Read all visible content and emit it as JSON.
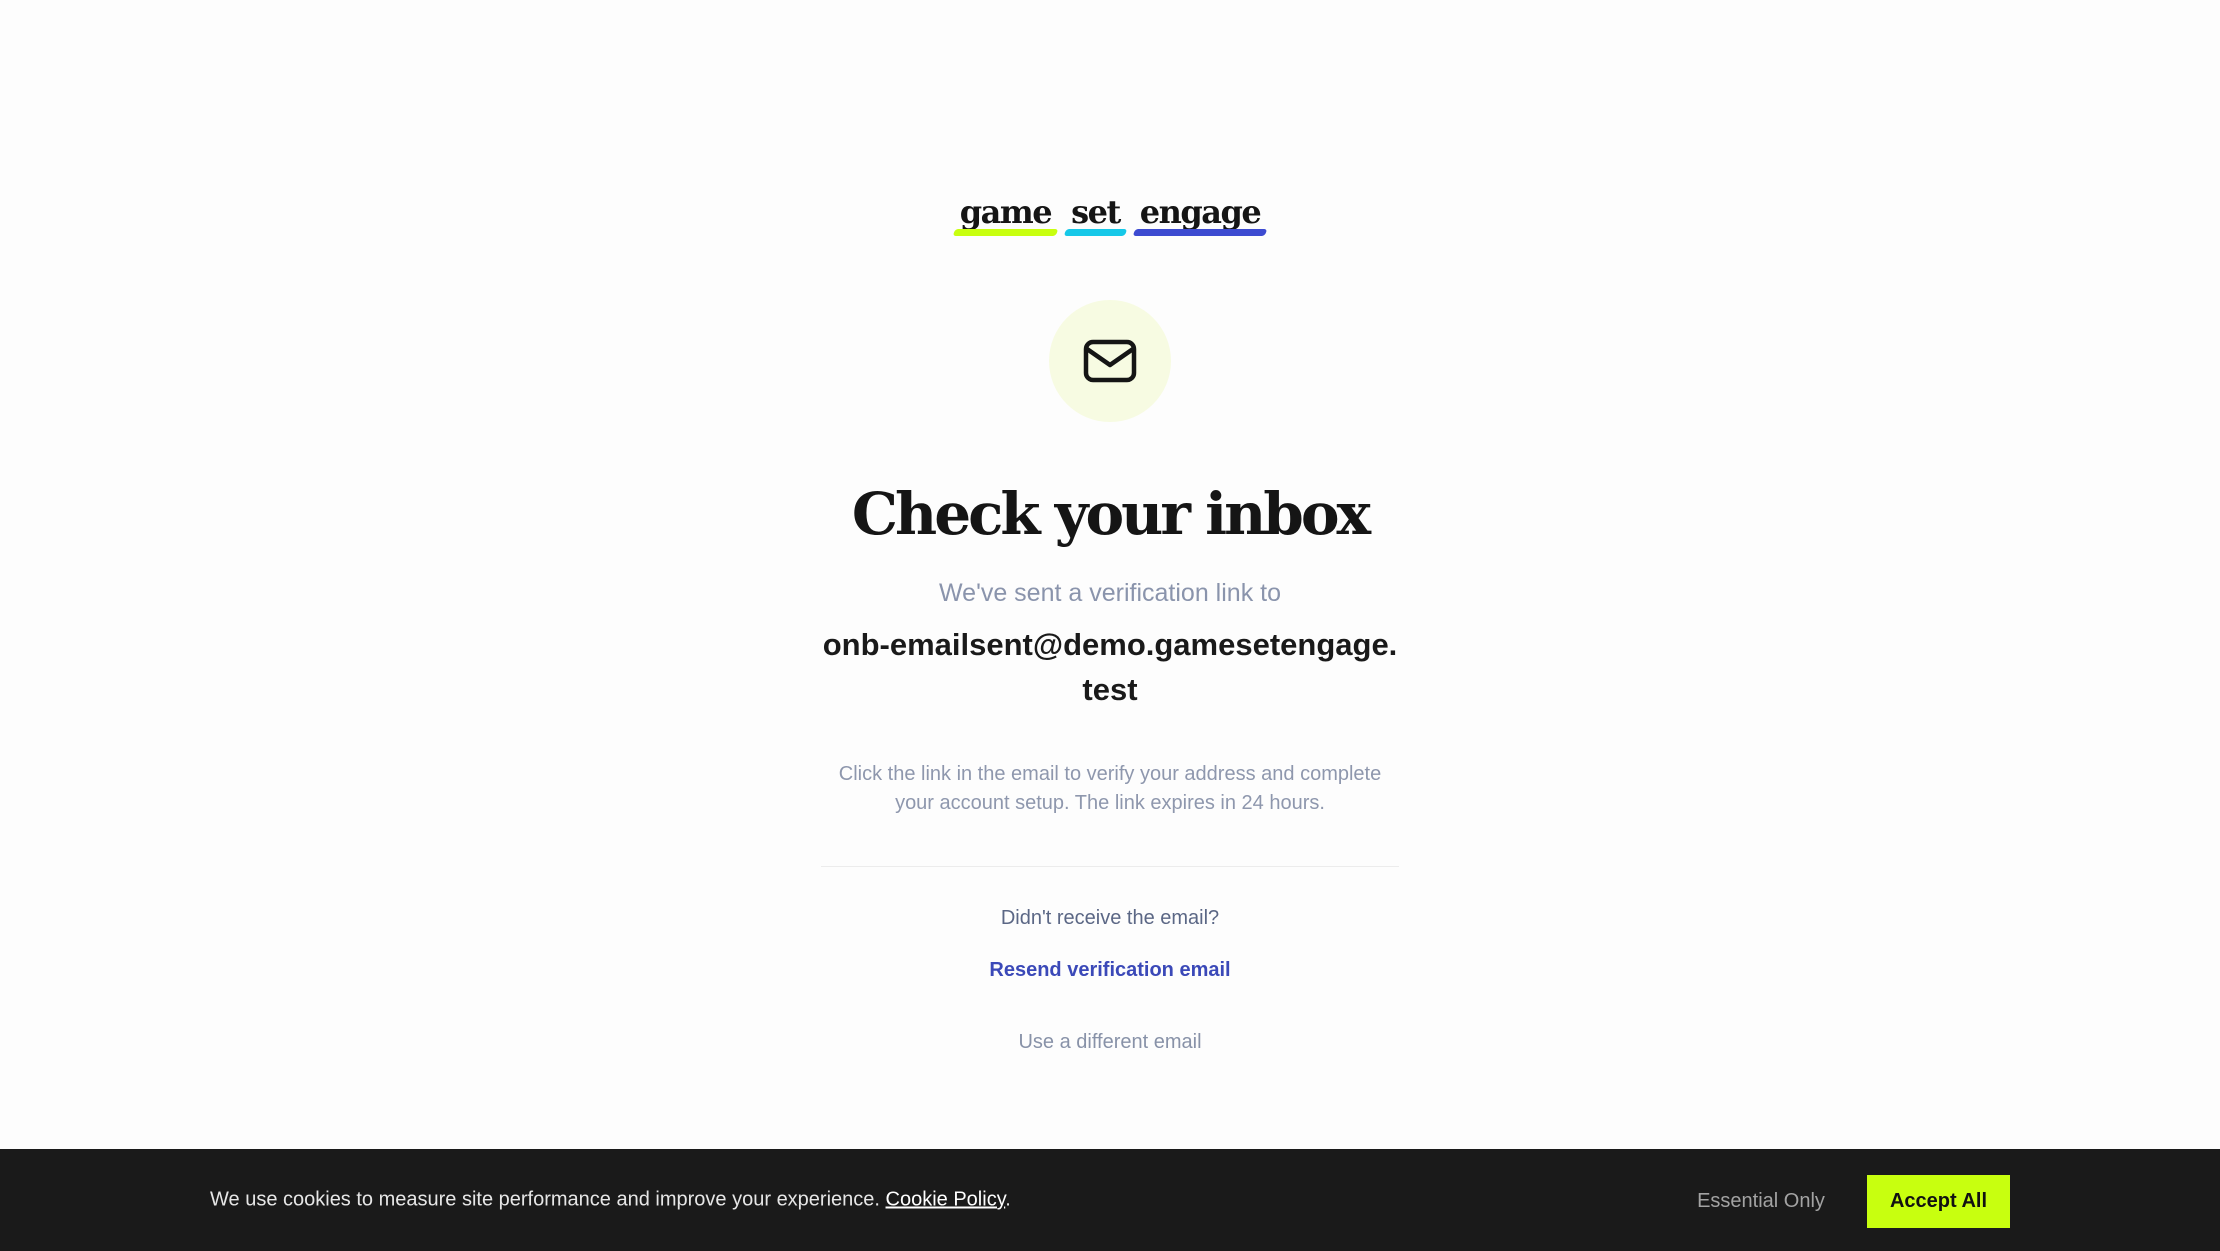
{
  "brand": {
    "words": [
      "game",
      "set",
      "engage"
    ],
    "bar_colors": [
      "#c8ff0f",
      "#16c8e8",
      "#3d4bd1"
    ]
  },
  "icon": "mail-icon",
  "heading": "Check your inbox",
  "sent_to_label": "We've sent a verification link to",
  "email": "onb-emailsent@demo.gamesetengage.test",
  "instructions": "Click the link in the email to verify your address and complete your account setup. The link expires in 24 hours.",
  "didnt_receive": "Didn't receive the email?",
  "resend_label": "Resend verification email",
  "different_email_label": "Use a different email",
  "cookie": {
    "message": "We use cookies to measure site performance and improve your experience.",
    "policy_link": "Cookie Policy",
    "policy_suffix": ".",
    "essential_label": "Essential Only",
    "accept_label": "Accept All"
  },
  "colors": {
    "accent": "#c8ff0f",
    "link": "#3b49b8",
    "banner_bg": "#1a1a1a",
    "icon_bg": "#f7fbe2"
  }
}
